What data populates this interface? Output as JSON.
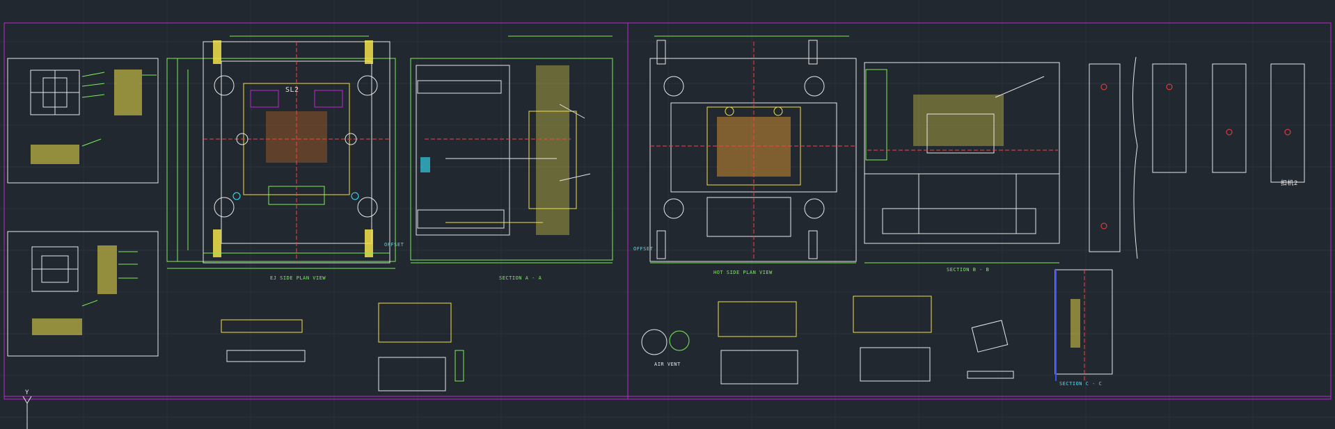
{
  "drawing": {
    "views": {
      "ejector_side": "EJ SIDE PLAN VIEW",
      "section_aa": "SECTION A - A",
      "hot_side": "HOT SIDE PLAN VIEW",
      "section_bb": "SECTION B - B",
      "section_cc": "SECTION C - C"
    },
    "annotations": {
      "air_vent": "AIR VENT",
      "offset_left": "OFFSET",
      "offset_right": "OFFSET",
      "sl2_mark": "SL2",
      "slider_cn": "扣机2",
      "ucs_y": "Y"
    }
  },
  "colors": {
    "background": "#212830",
    "frame": "#35e84a",
    "inner_frame": "#c026d3",
    "geometry": "#e8e8e8",
    "dimension": "#7cf05a",
    "hatch": "#f2e04a",
    "center": "#ff4040",
    "aux": "#38e8ff"
  }
}
